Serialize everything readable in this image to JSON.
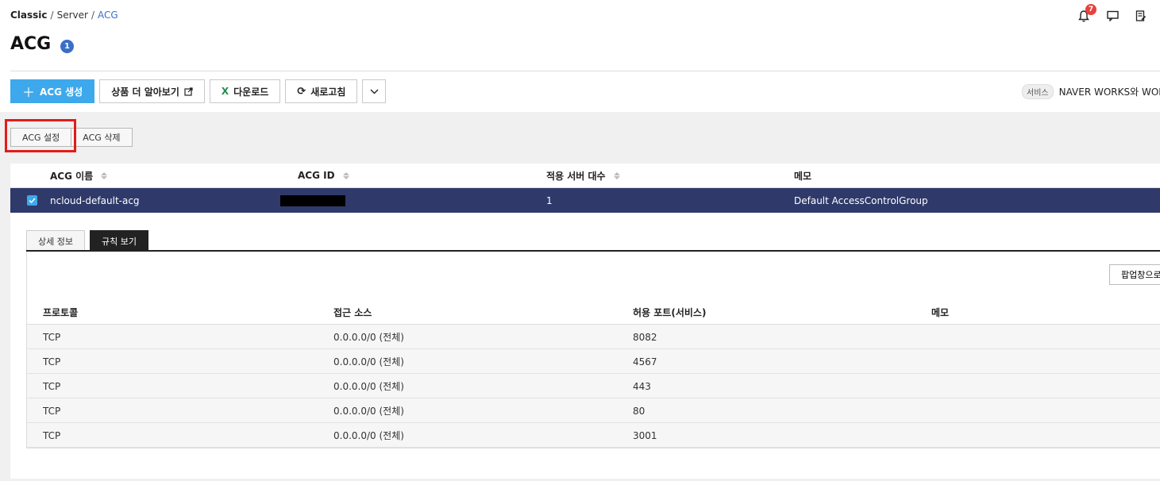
{
  "breadcrumb": {
    "root": "Classic",
    "mid": "Server",
    "current": "ACG",
    "sep": "/"
  },
  "header": {
    "title": "ACG",
    "count": "1",
    "notification_count": "7"
  },
  "toolbar": {
    "create_label": "ACG 생성",
    "learn_more_label": "상품 더 알아보기",
    "download_label": "다운로드",
    "refresh_label": "새로고침"
  },
  "service": {
    "tag": "서비스",
    "text": "NAVER WORKS와 WORKP"
  },
  "actions": {
    "settings_label": "ACG 설정",
    "delete_label": "ACG 삭제"
  },
  "grid": {
    "columns": [
      "ACG 이름",
      "ACG ID",
      "적용 서버 대수",
      "메모"
    ],
    "row": {
      "name": "ncloud-default-acg",
      "servers": "1",
      "memo": "Default AccessControlGroup"
    }
  },
  "tabs": {
    "detail": "상세 정보",
    "rules": "규칙 보기"
  },
  "rules": {
    "popup_label": "팝업창으로",
    "columns": [
      "프로토콜",
      "접근 소스",
      "허용 포트(서비스)",
      "메모"
    ],
    "rows": [
      {
        "protocol": "TCP",
        "source": "0.0.0.0/0 (전체)",
        "port": "8082",
        "memo": ""
      },
      {
        "protocol": "TCP",
        "source": "0.0.0.0/0 (전체)",
        "port": "4567",
        "memo": ""
      },
      {
        "protocol": "TCP",
        "source": "0.0.0.0/0 (전체)",
        "port": "443",
        "memo": ""
      },
      {
        "protocol": "TCP",
        "source": "0.0.0.0/0 (전체)",
        "port": "80",
        "memo": ""
      },
      {
        "protocol": "TCP",
        "source": "0.0.0.0/0 (전체)",
        "port": "3001",
        "memo": ""
      }
    ]
  },
  "colors": {
    "primary": "#3ea8ec",
    "selected_row": "#2f3a6a",
    "accent": "#3b6fc7",
    "highlight": "#e31b1b"
  }
}
